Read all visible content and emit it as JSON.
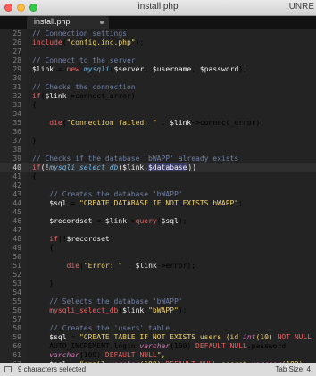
{
  "window": {
    "title": "install.php",
    "right_text": "UNRE"
  },
  "tab": {
    "label": "install.php"
  },
  "lines": [
    {
      "n": "25",
      "text": "// Connection settings"
    },
    {
      "n": "26",
      "text": "include(\"config.inc.php\");"
    },
    {
      "n": "27",
      "text": ""
    },
    {
      "n": "28",
      "text": "// Connect to the server"
    },
    {
      "n": "29",
      "text": "$link = new mysqli($server, $username, $password);"
    },
    {
      "n": "30",
      "text": ""
    },
    {
      "n": "31",
      "text": "// Checks the connection"
    },
    {
      "n": "32",
      "text": "if($link->connect_error)"
    },
    {
      "n": "33",
      "text": "{"
    },
    {
      "n": "34",
      "text": ""
    },
    {
      "n": "35",
      "text": "    die(\"Connection failed: \" . $link->connect_error);"
    },
    {
      "n": "36",
      "text": ""
    },
    {
      "n": "37",
      "text": "}"
    },
    {
      "n": "38",
      "text": ""
    },
    {
      "n": "39",
      "text": "// Checks if the database 'bWAPP' already exists"
    },
    {
      "n": "40",
      "text": "if(!mysqli_select_db($link,$database))"
    },
    {
      "n": "41",
      "text": "{"
    },
    {
      "n": "42",
      "text": ""
    },
    {
      "n": "43",
      "text": "    // Creates the database 'bWAPP'"
    },
    {
      "n": "44",
      "text": "    $sql = \"CREATE DATABASE IF NOT EXISTS bWAPP\";"
    },
    {
      "n": "45",
      "text": ""
    },
    {
      "n": "46",
      "text": "    $recordset = $link->query($sql);"
    },
    {
      "n": "47",
      "text": ""
    },
    {
      "n": "48",
      "text": "    if(!$recordset)"
    },
    {
      "n": "49",
      "text": "    {"
    },
    {
      "n": "50",
      "text": ""
    },
    {
      "n": "51",
      "text": "        die(\"Error: \" . $link->error);"
    },
    {
      "n": "52",
      "text": ""
    },
    {
      "n": "53",
      "text": "    }"
    },
    {
      "n": "54",
      "text": ""
    },
    {
      "n": "55",
      "text": "    // Selects the database 'bWAPP'"
    },
    {
      "n": "56",
      "text": "    mysqli_select_db($link,\"bWAPP\");"
    },
    {
      "n": "57",
      "text": ""
    },
    {
      "n": "58",
      "text": "    // Creates the 'users' table"
    },
    {
      "n": "59",
      "text": "    $sql = \"CREATE TABLE IF NOT EXISTS users (id int(10) NOT NULL"
    },
    {
      "n": "60",
      "text": "    AUTO_INCREMENT,login varchar(100) DEFAULT NULL,password"
    },
    {
      "n": "61",
      "text": "    varchar(100) DEFAULT NULL\","
    },
    {
      "n": "62",
      "text": "    $sql = \"email varchar(100) DEFAULT NULL,secret varchar(100)"
    }
  ],
  "status": {
    "selection": "9 characters selected",
    "tab_size": "Tab Size: 4"
  },
  "colors": {
    "background": "#232323",
    "gutter": "#252525",
    "comment": "#6f7fa3",
    "string": "#f0d36a",
    "function": "#e36464"
  }
}
